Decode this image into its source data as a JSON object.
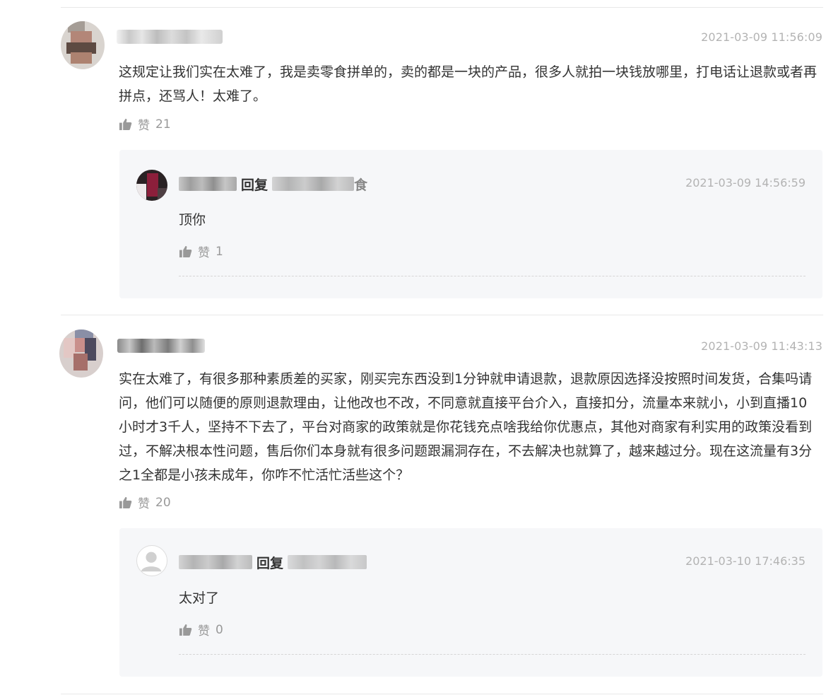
{
  "comments": [
    {
      "time": "2021-03-09 11:56:09",
      "text": "这规定让我们实在太难了，我是卖零食拼单的，卖的都是一块的产品，很多人就拍一块钱放哪里，打电话让退款或者再拼点，还骂人！太难了。",
      "like_label": "赞",
      "like_count": "21",
      "reply": {
        "reply_word": "回复",
        "reply_tail": "食",
        "time": "2021-03-09 14:56:59",
        "text": "顶你",
        "like_label": "赞",
        "like_count": "1"
      }
    },
    {
      "time": "2021-03-09 11:43:13",
      "text": "实在太难了，有很多那种素质差的买家，刚买完东西没到1分钟就申请退款，退款原因选择没按照时间发货，合集吗请问，他们可以随便的原则退款理由，让他改也不改，不同意就直接平台介入，直接扣分，流量本来就小，小到直播10小时才3千人，坚持不下去了，平台对商家的政策就是你花钱充点啥我给你优惠点，其他对商家有利实用的政策没看到过，不解决根本性问题，售后你们本身就有很多问题跟漏洞存在，不去解决也就算了，越来越过分。现在这流量有3分之1全都是小孩未成年，你咋不忙活忙活些这个？",
      "like_label": "赞",
      "like_count": "20",
      "reply": {
        "reply_word": "回复",
        "time": "2021-03-10 17:46:35",
        "text": "太对了",
        "like_label": "赞",
        "like_count": "0"
      }
    }
  ],
  "icons": {
    "like": "thumbs-up-icon",
    "default_avatar": "user-silhouette-icon"
  },
  "colors": {
    "text": "#333333",
    "muted": "#999999",
    "timestamp": "#b3b3b3",
    "reply_bg": "#f6f7f9"
  }
}
